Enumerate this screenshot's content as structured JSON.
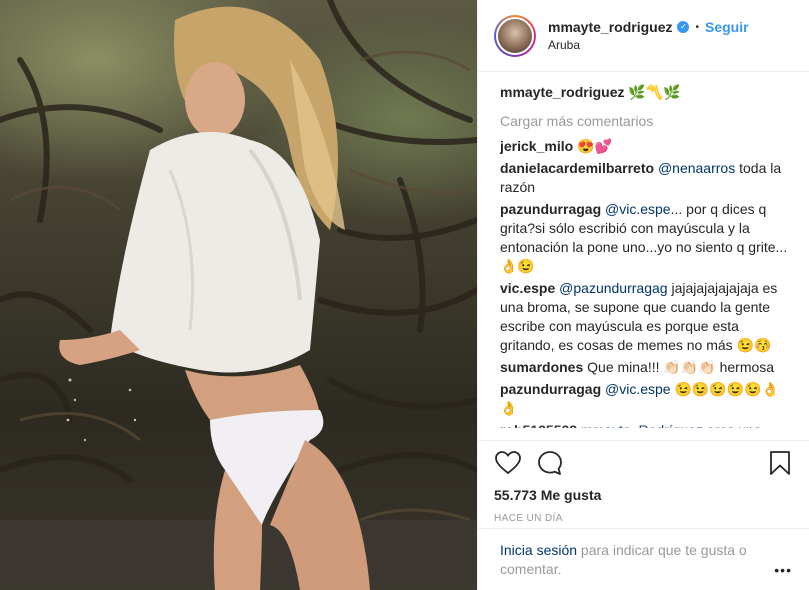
{
  "post": {
    "username": "mmayte_rodriguez",
    "separator": "•",
    "follow_label": "Seguir",
    "location": "Aruba",
    "verified_icon": "check-badge-icon"
  },
  "caption": {
    "username": "mmayte_rodriguez",
    "text": " 🌿〽️🌿"
  },
  "load_more_label": "Cargar más comentarios",
  "comments": [
    {
      "user": "jerick_milo",
      "mention": "",
      "text": " 😍💕"
    },
    {
      "user": "danielacardemilbarreto",
      "mention": " @nenaarros",
      "text": " toda la razón"
    },
    {
      "user": "pazundurragag",
      "mention": " @vic.espe",
      "text": "... por q dices q grita?si sólo escribió con mayúscula y la entonación la pone uno...yo no siento q grite...👌😉"
    },
    {
      "user": "vic.espe",
      "mention": " @pazundurragag",
      "text": " jajajajajajajaja es una broma, se supone que cuando la gente escribe con mayúscula es porque esta gritando, es cosas de memes no más 😉😚"
    },
    {
      "user": "sumardones",
      "mention": "",
      "text": " Que mina!!! 👏🏻👏🏻👏🏻 hermosa"
    },
    {
      "user": "pazundurragag",
      "mention": " @vic.espe",
      "text": " 😉😉😉😉😉👌👌"
    },
    {
      "user": "rob5125528",
      "mention": " mmayte_Rodríguez",
      "text": " eres una..."
    }
  ],
  "actions": {
    "like_icon": "heart-icon",
    "comment_icon": "speech-bubble-icon",
    "save_icon": "bookmark-icon",
    "likes": "55.773 Me gusta",
    "time": "Hace un día"
  },
  "login": {
    "link": "Inicia sesión",
    "rest": " para indicar que te gusta o comentar.",
    "more": "•••"
  },
  "colors": {
    "accent": "#3897f0",
    "muted": "#999999",
    "mention": "#003569",
    "border": "#efefef"
  }
}
